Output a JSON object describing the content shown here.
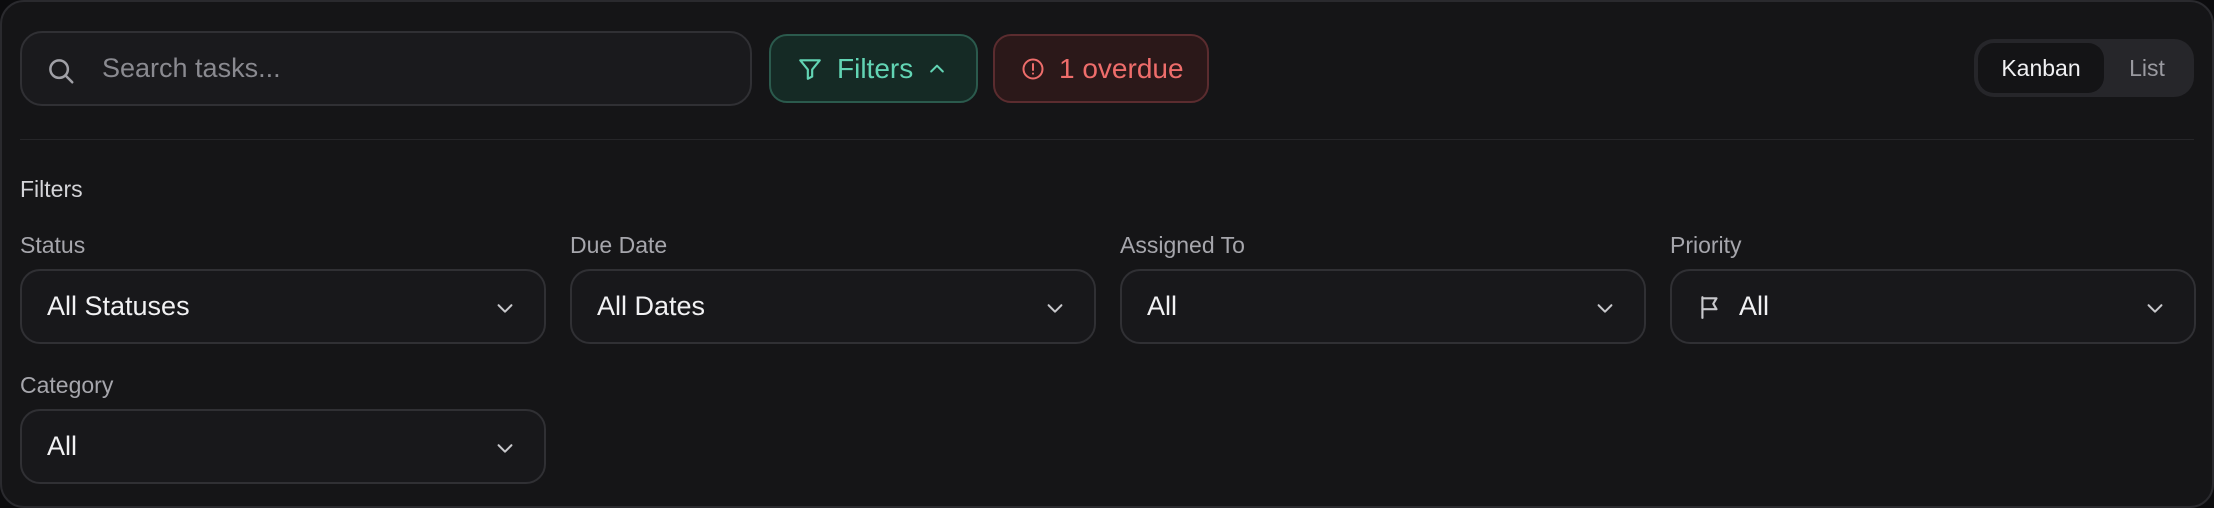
{
  "toolbar": {
    "search_placeholder": "Search tasks...",
    "filters_label": "Filters",
    "overdue_label": "1 overdue",
    "view_options": {
      "kanban": "Kanban",
      "list": "List",
      "active": "Kanban"
    }
  },
  "filters_panel": {
    "title": "Filters",
    "fields": {
      "status": {
        "label": "Status",
        "value": "All Statuses"
      },
      "due_date": {
        "label": "Due Date",
        "value": "All Dates"
      },
      "assigned_to": {
        "label": "Assigned To",
        "value": "All"
      },
      "priority": {
        "label": "Priority",
        "value": "All"
      },
      "category": {
        "label": "Category",
        "value": "All"
      }
    }
  },
  "icons": {
    "search": "search-icon",
    "filter": "filter-funnel-icon",
    "collapse": "chevron-up-icon",
    "alert": "alert-circle-icon",
    "dropdown": "chevron-down-icon",
    "priority": "flag-icon"
  },
  "colors": {
    "accent_green": "#62d4b4",
    "alert_red": "#ee6d6b",
    "background": "#151517"
  }
}
